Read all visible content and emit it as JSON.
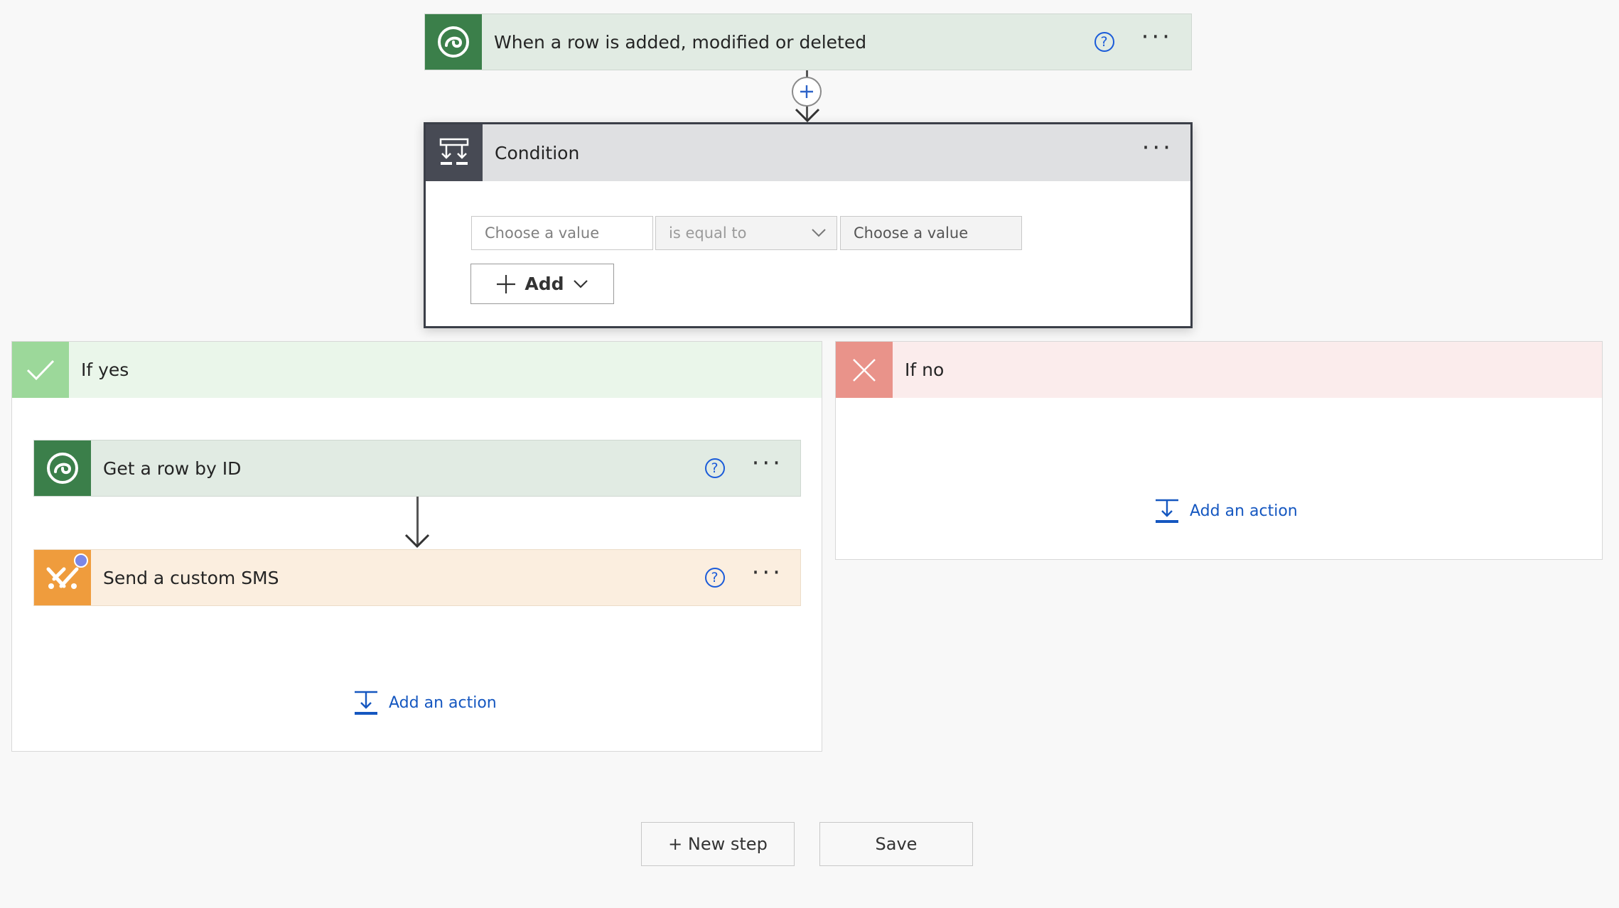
{
  "trigger": {
    "title": "When a row is added, modified or deleted",
    "help": "?",
    "more": "···"
  },
  "condition": {
    "title": "Condition",
    "more": "···",
    "left_placeholder": "Choose a value",
    "operator": "is equal to",
    "right_placeholder": "Choose a value",
    "add_label": "Add"
  },
  "if_yes": {
    "label": "If yes",
    "actions": [
      {
        "title": "Get a row by ID",
        "help": "?",
        "more": "···"
      },
      {
        "title": "Send a custom SMS",
        "help": "?",
        "more": "···"
      }
    ],
    "add_action": "Add an action"
  },
  "if_no": {
    "label": "If no",
    "add_action": "Add an action"
  },
  "footer": {
    "new_step": "+ New step",
    "save": "Save"
  },
  "colors": {
    "dataverse_green": "#3b7f4a",
    "dataverse_bg": "#e1ebe3",
    "condition_dark": "#474a54",
    "condition_bg": "#dfe0e2",
    "yes_green": "#9cd89a",
    "yes_bg": "#eaf6ea",
    "no_red": "#e9938a",
    "no_bg": "#fbecec",
    "sms_orange": "#ef9c3d",
    "sms_bg": "#fbeedf",
    "link_blue": "#1557c0"
  },
  "icons": {
    "trigger": "dataverse-icon",
    "condition": "condition-icon",
    "yes": "check-icon",
    "no": "x-icon",
    "sms": "sms-connector-icon",
    "add_action": "add-action-icon"
  }
}
